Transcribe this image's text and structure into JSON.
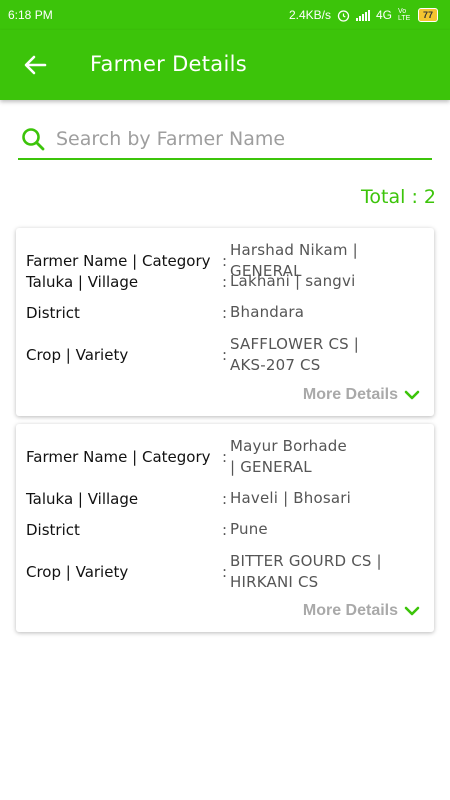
{
  "status": {
    "time": "6:18 PM",
    "speed": "2.4KB/s",
    "network": "4G",
    "volte": "Vo LTE",
    "battery": "77"
  },
  "appbar": {
    "title": "Farmer Details"
  },
  "search": {
    "placeholder": "Search by Farmer Name"
  },
  "total_label": "Total : 2",
  "more_label": "More Details",
  "colors": {
    "accent": "#3cc40a",
    "muted": "#a9a9a9"
  },
  "cards": [
    {
      "rows": [
        {
          "label": "Farmer Name | Category",
          "sep": ":",
          "value": "Harshad Nikam | GENERAL"
        },
        {
          "label": "Taluka | Village",
          "sep": ":",
          "value": "Lakhani | sangvi"
        },
        {
          "label": "District",
          "sep": ":",
          "value": "Bhandara"
        },
        {
          "label": "Crop | Variety",
          "sep": ":",
          "value": "SAFFLOWER CS | AKS-207 CS"
        }
      ]
    },
    {
      "rows": [
        {
          "label": "Farmer Name | Category",
          "sep": ":",
          "value": "Mayur Borhade | GENERAL"
        },
        {
          "label": "Taluka | Village",
          "sep": ":",
          "value": "Haveli | Bhosari"
        },
        {
          "label": "District",
          "sep": ":",
          "value": "Pune"
        },
        {
          "label": "Crop | Variety",
          "sep": ":",
          "value": "BITTER GOURD CS | HIRKANI CS"
        }
      ]
    }
  ]
}
